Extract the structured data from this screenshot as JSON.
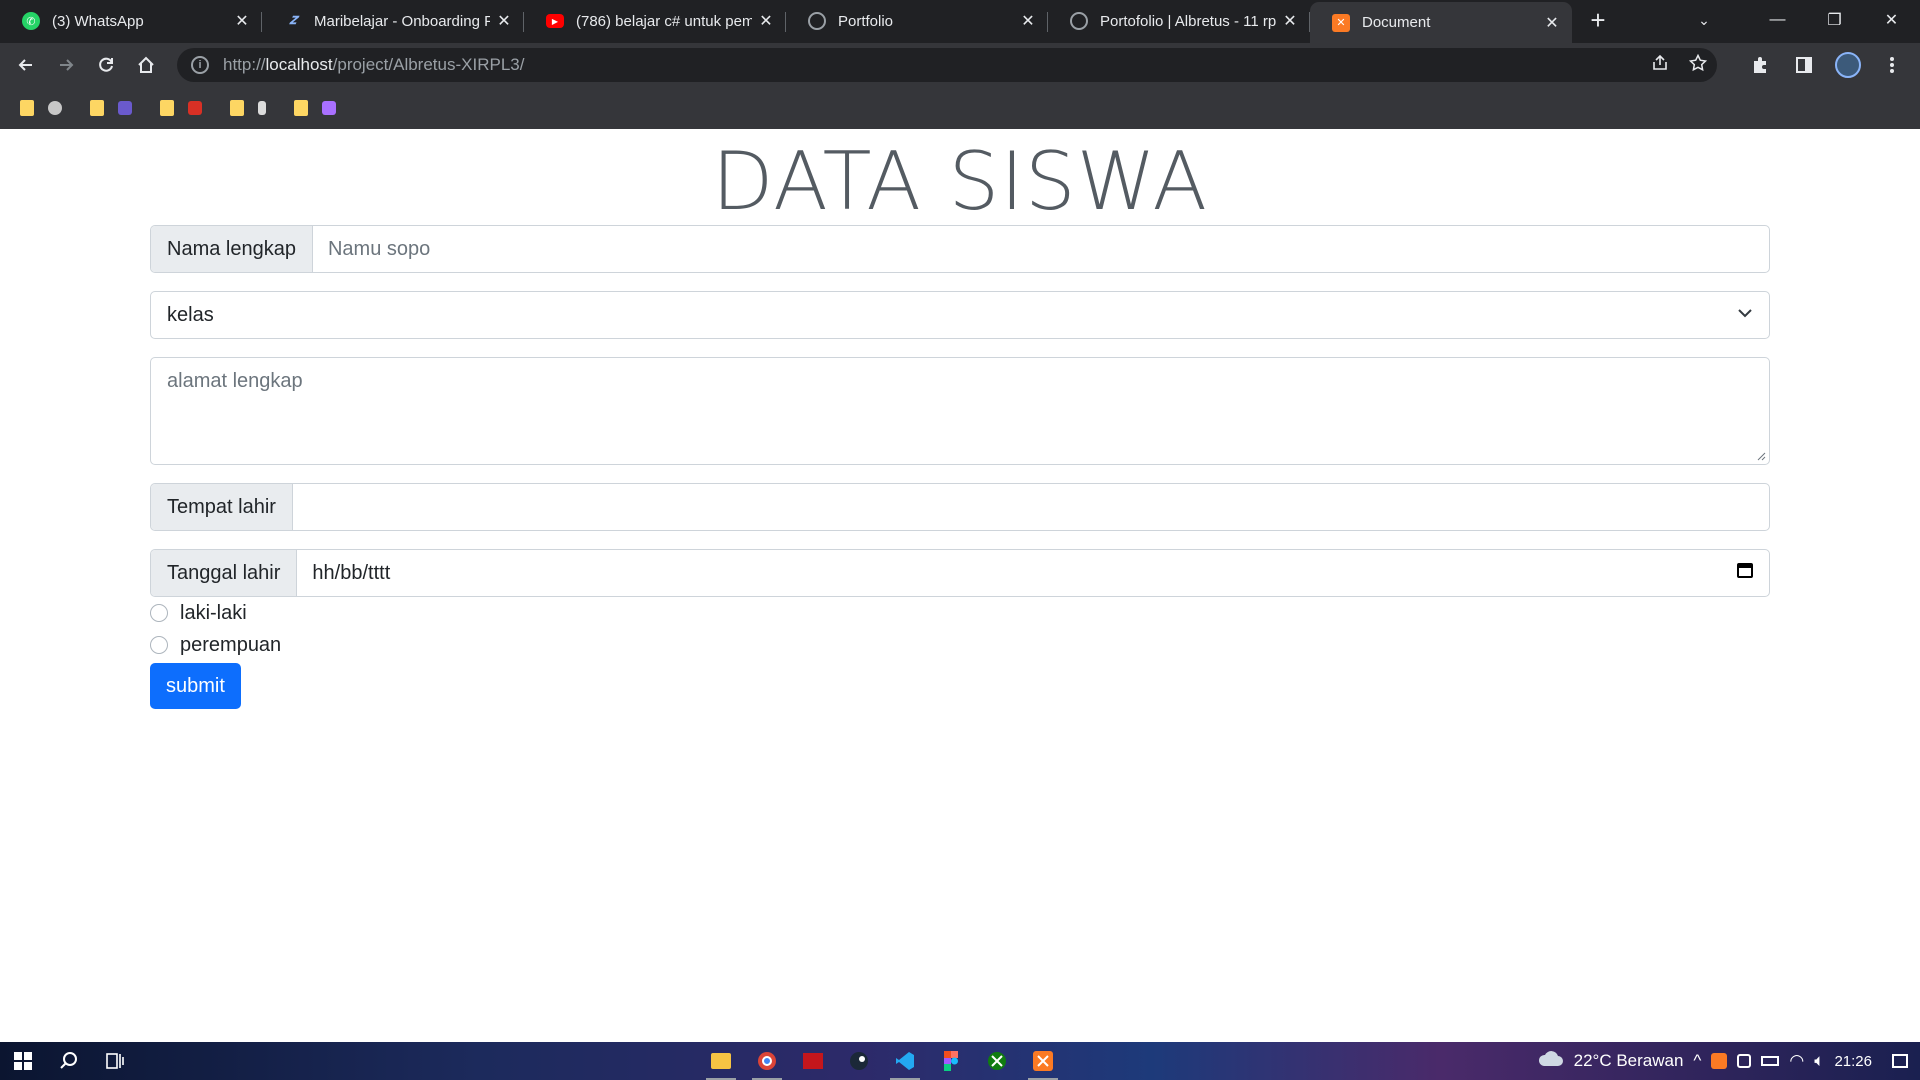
{
  "browser": {
    "tabs": [
      {
        "title": "(3) WhatsApp",
        "favicon": "whatsapp-icon",
        "color": "#25d366",
        "active": false
      },
      {
        "title": "Maribelajar - Onboarding P",
        "favicon": "maribelajar-icon",
        "color": "#4a7bd0",
        "active": false
      },
      {
        "title": "(786) belajar c# untuk pemu",
        "favicon": "youtube-icon",
        "color": "#ff0000",
        "active": false
      },
      {
        "title": "Portfolio",
        "favicon": "globe-icon",
        "color": "#9aa0a6",
        "active": false
      },
      {
        "title": "Portofolio | Albretus - 11 rp",
        "favicon": "globe-icon",
        "color": "#9aa0a6",
        "active": false
      },
      {
        "title": "Document",
        "favicon": "xampp-icon",
        "color": "#fb7a24",
        "active": true
      }
    ],
    "url": {
      "scheme": "http://",
      "host": "localhost",
      "path": "/project/Albretus-XIRPL3/"
    }
  },
  "page": {
    "heading": "DATA SISWA",
    "nama": {
      "label": "Nama lengkap",
      "placeholder": "Namu sopo"
    },
    "kelas": {
      "selected": "kelas"
    },
    "alamat": {
      "placeholder": "alamat lengkap"
    },
    "tempat": {
      "label": "Tempat lahir",
      "value": ""
    },
    "tanggal": {
      "label": "Tanggal lahir",
      "value": "hh/bb/tttt"
    },
    "gender": [
      {
        "label": "laki-laki",
        "checked": false
      },
      {
        "label": "perempuan",
        "checked": false
      }
    ],
    "submit_label": "submit"
  },
  "taskbar": {
    "weather": "22°C  Berawan",
    "time": "21:26"
  },
  "colors": {
    "primary": "#0d6efd",
    "chrome_dark": "#202124",
    "chrome_toolbar": "#35363a"
  }
}
